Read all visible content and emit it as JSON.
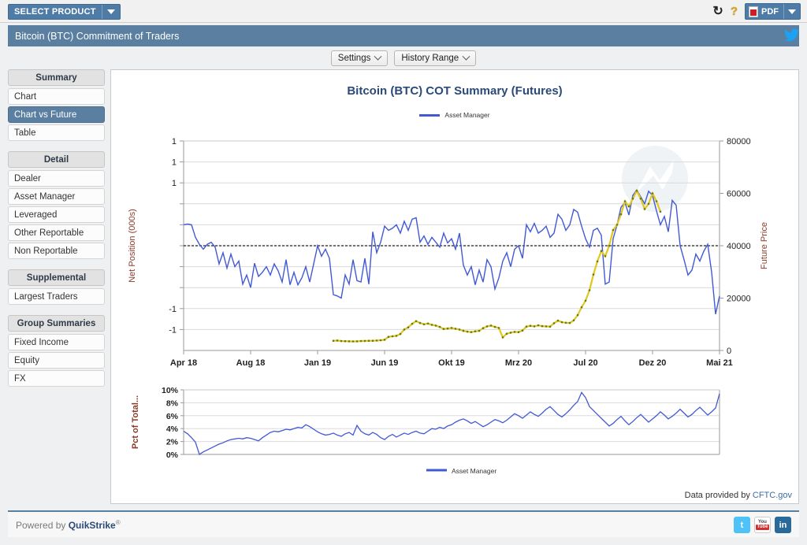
{
  "topbar": {
    "select_product_label": "SELECT PRODUCT",
    "dropdown_icon": "caret-down-icon",
    "refresh_icon": "refresh-icon",
    "refresh_glyph": "↻",
    "help_icon": "question-mark-icon",
    "help_glyph": "?",
    "pdf_label": "PDF",
    "pdf_icon": "pdf-file-icon"
  },
  "product": {
    "title": "Bitcoin (BTC) Commitment of Traders",
    "twitter_icon": "twitter-bird-icon",
    "twitter_glyph": "ᴠ"
  },
  "toolbar": {
    "settings_label": "Settings",
    "history_range_label": "History Range"
  },
  "sidebar": {
    "groups": [
      {
        "header": "Summary",
        "items": [
          {
            "label": "Chart",
            "active": false
          },
          {
            "label": "Chart vs Future",
            "active": true
          },
          {
            "label": "Table",
            "active": false
          }
        ]
      },
      {
        "header": "Detail",
        "items": [
          {
            "label": "Dealer",
            "active": false
          },
          {
            "label": "Asset Manager",
            "active": false
          },
          {
            "label": "Leveraged",
            "active": false
          },
          {
            "label": "Other Reportable",
            "active": false
          },
          {
            "label": "Non Reportable",
            "active": false
          }
        ]
      },
      {
        "header": "Supplemental",
        "items": [
          {
            "label": "Largest Traders",
            "active": false
          }
        ]
      },
      {
        "header": "Group Summaries",
        "items": [
          {
            "label": "Fixed Income",
            "active": false
          },
          {
            "label": "Equity",
            "active": false
          },
          {
            "label": "FX",
            "active": false
          }
        ]
      }
    ]
  },
  "panel": {
    "chart_title": "Bitcoin (BTC) COT Summary (Futures)",
    "legend_label": "Asset Manager",
    "sub_legend_label": "Asset Manager",
    "data_provided_prefix": "Data provided by ",
    "data_provided_link": "CFTC.gov",
    "watermark_icon": "quikstrike-watermark-icon"
  },
  "footer": {
    "powered_prefix": "Powered by ",
    "powered_brand": "QuikStrike",
    "powered_sup": "®",
    "twitter_icon": "twitter-icon",
    "twitter_glyph": "t",
    "youtube_icon": "youtube-icon",
    "youtube_top": "You",
    "youtube_bottom": "Tube",
    "linkedin_icon": "linkedin-icon",
    "linkedin_glyph": "in"
  },
  "colors": {
    "accent_blue": "#5b7fa0",
    "series_net_position": "#4259d4",
    "series_future_price": "#e0c81e",
    "title_blue": "#2b4a78",
    "axis_label_brown": "#8b3a2a"
  },
  "chart_data": {
    "type": "line",
    "title": "Bitcoin (BTC) COT Summary (Futures)",
    "xlabel": "",
    "ylabel": "Net Position (000s)",
    "y2label": "Future Price",
    "grid": true,
    "legend_position": "top",
    "x_ticks": [
      "Apr 18",
      "Aug 18",
      "Jan 19",
      "Jun 19",
      "Okt 19",
      "Mrz 20",
      "Jul 20",
      "Dez 20",
      "Mai 21"
    ],
    "y_ticks_left": [
      "1",
      "1",
      "1",
      "",
      "",
      "",
      "",
      "",
      "-1",
      "-1"
    ],
    "y_ticks_left_note": "left axis tick labels are clipped to a single digit in the rendering",
    "ylim": [
      -1.5,
      1.5
    ],
    "y_ticks_right": [
      0,
      20000,
      40000,
      60000,
      80000
    ],
    "y2lim": [
      0,
      80000
    ],
    "zero_line": true,
    "series": [
      {
        "name": "Asset Manager",
        "axis": "left",
        "color": "#4259d4",
        "values": [
          0.3,
          0.31,
          0.3,
          0.12,
          0.02,
          -0.05,
          0.02,
          0.05,
          -0.02,
          -0.26,
          -0.1,
          -0.32,
          -0.12,
          -0.3,
          -0.22,
          -0.55,
          -0.42,
          -0.6,
          -0.25,
          -0.44,
          -0.38,
          -0.3,
          -0.42,
          -0.26,
          -0.36,
          -0.52,
          -0.2,
          -0.56,
          -0.38,
          -0.56,
          -0.46,
          -0.3,
          -0.52,
          -0.26,
          0.0,
          -0.15,
          -0.05,
          -0.18,
          -0.7,
          -0.72,
          -0.75,
          -0.42,
          -0.55,
          -0.2,
          -0.5,
          -0.52,
          -0.18,
          -0.55,
          0.2,
          -0.1,
          0.05,
          0.28,
          0.22,
          0.25,
          0.3,
          0.18,
          0.35,
          0.22,
          0.38,
          0.4,
          0.05,
          0.14,
          0.02,
          0.12,
          0.05,
          -0.02,
          0.18,
          0.04,
          0.1,
          -0.05,
          0.18,
          -0.28,
          -0.42,
          -0.3,
          -0.56,
          -0.35,
          -0.52,
          -0.2,
          -0.3,
          -0.62,
          -0.46,
          -0.22,
          -0.1,
          -0.3,
          -0.05,
          0.0,
          -0.18,
          0.3,
          0.2,
          0.32,
          0.18,
          0.22,
          0.28,
          0.12,
          0.18,
          0.45,
          0.38,
          0.22,
          0.3,
          0.52,
          0.48,
          0.28,
          0.1,
          -0.02,
          0.22,
          0.25,
          0.15,
          -0.55,
          -0.52,
          0.1,
          0.3,
          0.55,
          0.62,
          0.44,
          0.72,
          0.8,
          0.7,
          0.6,
          0.78,
          0.72,
          0.5,
          0.3,
          0.42,
          0.2,
          0.65,
          0.58,
          0.0,
          -0.2,
          -0.42,
          -0.35,
          -0.12,
          -0.22,
          -0.08,
          0.02,
          -0.38,
          -0.98,
          -0.72
        ]
      },
      {
        "name": "Future Price",
        "axis": "right",
        "color": "#e0c81e",
        "style": "dotted",
        "start_index": 38,
        "values": [
          3700,
          3800,
          3600,
          3550,
          3500,
          3450,
          3500,
          3600,
          3650,
          3700,
          3700,
          3800,
          3900,
          4100,
          5200,
          5400,
          5600,
          6300,
          8000,
          8800,
          10200,
          11200,
          10500,
          10000,
          10300,
          9800,
          9500,
          9000,
          8200,
          8400,
          8600,
          8300,
          8000,
          7500,
          7200,
          7000,
          7300,
          7500,
          8500,
          9200,
          9500,
          9000,
          8600,
          5000,
          6400,
          6800,
          7100,
          7000,
          7600,
          9100,
          9400,
          9200,
          9600,
          9300,
          9200,
          9100,
          10400,
          11400,
          10800,
          10600,
          10500,
          11500,
          13500,
          16500,
          19000,
          23000,
          29000,
          34000,
          38000,
          36000,
          40000,
          46000,
          48000,
          52000,
          57000,
          55000,
          58000,
          61000,
          58000,
          54000,
          56000,
          60000,
          57000,
          53000
        ]
      }
    ],
    "subchart": {
      "type": "line",
      "ylabel": "Pct of Total...",
      "color": "#4259d4",
      "legend_label": "Asset Manager",
      "y_ticks": [
        "0%",
        "2%",
        "4%",
        "6%",
        "8%",
        "10%"
      ],
      "ylim": [
        0,
        10
      ],
      "values": [
        3.6,
        3.2,
        2.6,
        1.9,
        0.0,
        0.4,
        0.7,
        1.0,
        1.3,
        1.6,
        1.8,
        2.1,
        2.3,
        2.4,
        2.5,
        2.4,
        2.6,
        2.5,
        2.3,
        2.1,
        2.6,
        3.0,
        3.4,
        3.6,
        3.5,
        3.7,
        3.9,
        3.8,
        4.0,
        4.2,
        4.1,
        4.6,
        4.3,
        3.9,
        3.5,
        3.2,
        3.0,
        3.1,
        3.3,
        3.0,
        2.8,
        3.2,
        3.4,
        3.0,
        4.5,
        3.6,
        3.2,
        3.0,
        3.4,
        3.1,
        2.6,
        2.3,
        2.8,
        3.1,
        2.7,
        3.0,
        3.3,
        3.1,
        3.4,
        3.6,
        3.3,
        3.2,
        3.6,
        4.0,
        3.9,
        4.2,
        4.0,
        4.4,
        4.6,
        5.0,
        5.3,
        5.5,
        5.2,
        4.8,
        5.1,
        4.7,
        4.3,
        4.6,
        5.0,
        5.4,
        5.2,
        4.9,
        5.3,
        5.8,
        6.3,
        6.0,
        5.6,
        6.1,
        6.6,
        6.2,
        5.9,
        6.4,
        7.0,
        7.4,
        6.8,
        6.2,
        5.8,
        6.3,
        6.9,
        7.6,
        8.2,
        9.6,
        8.8,
        7.4,
        6.8,
        6.2,
        5.6,
        5.0,
        4.4,
        4.8,
        5.4,
        5.9,
        5.2,
        4.6,
        5.1,
        5.7,
        6.2,
        5.6,
        5.0,
        5.5,
        6.0,
        6.6,
        6.1,
        5.5,
        5.9,
        6.4,
        7.0,
        6.4,
        5.8,
        6.2,
        6.8,
        7.3,
        6.7,
        6.1,
        6.6,
        7.2,
        9.4
      ]
    }
  }
}
